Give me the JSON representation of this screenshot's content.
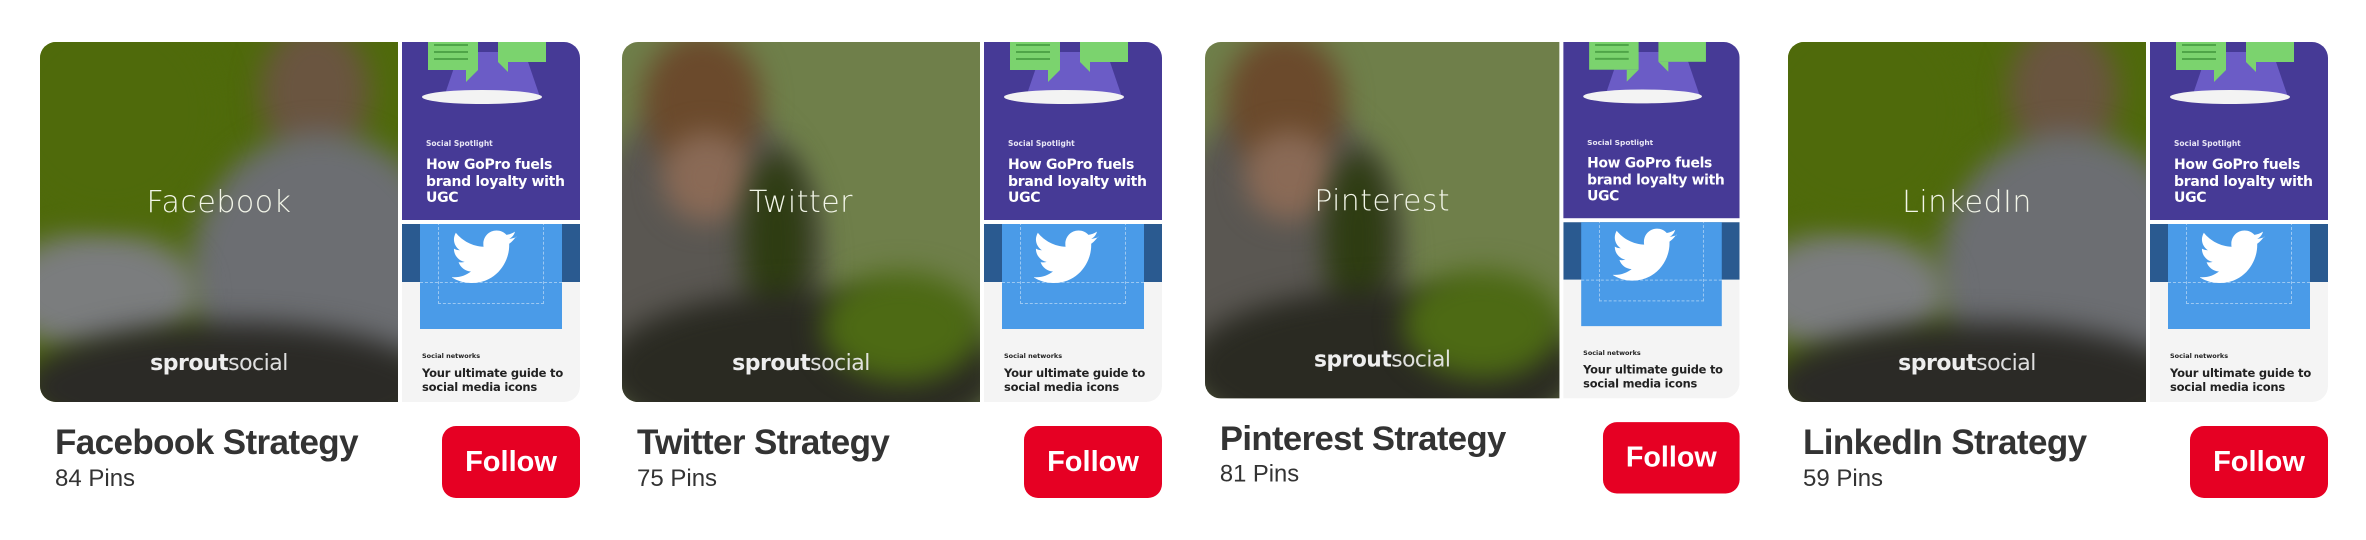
{
  "boards": [
    {
      "overlay_label": "Facebook",
      "title": "Facebook Strategy",
      "pin_count": "84 Pins",
      "follow_label": "Follow",
      "photo_theme": "green"
    },
    {
      "overlay_label": "Twitter",
      "title": "Twitter Strategy",
      "pin_count": "75 Pins",
      "follow_label": "Follow",
      "photo_theme": "olive"
    },
    {
      "overlay_label": "Pinterest",
      "title": "Pinterest Strategy",
      "pin_count": "81 Pins",
      "follow_label": "Follow",
      "photo_theme": "olive"
    },
    {
      "overlay_label": "LinkedIn",
      "title": "LinkedIn Strategy",
      "pin_count": "59 Pins",
      "follow_label": "Follow",
      "photo_theme": "green"
    }
  ],
  "cover_logo": {
    "bold": "sprout",
    "light": "social"
  },
  "tile_top": {
    "kicker": "Social Spotlight",
    "headline": "How GoPro fuels brand loyalty with UGC"
  },
  "tile_bottom": {
    "kicker": "Social networks",
    "headline": "Your ultimate guide to social media icons",
    "icon": "twitter-bird-icon"
  },
  "colors": {
    "follow_button": "#e60023",
    "title_text": "#333333",
    "tile_purple": "#463a96",
    "tile_blue": "#4a9be8",
    "photo_green": "#4f6a0b",
    "photo_olive": "#6f7f4a"
  }
}
